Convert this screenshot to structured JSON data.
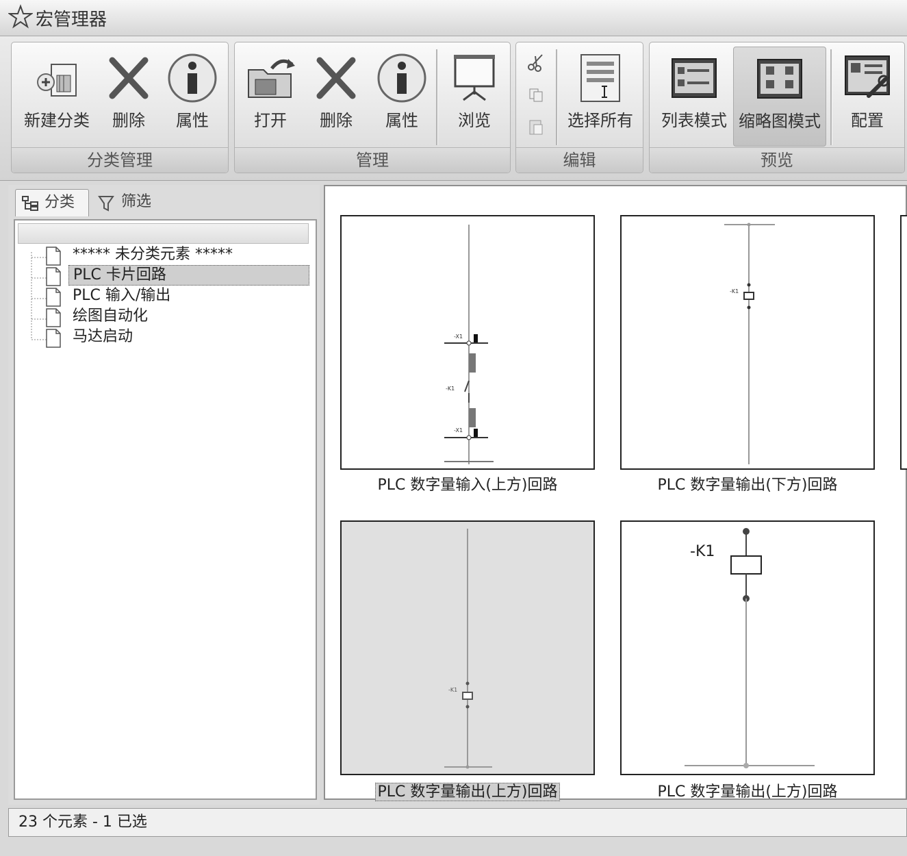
{
  "window": {
    "title": "宏管理器"
  },
  "ribbon": {
    "groups": [
      {
        "title": "分类管理",
        "buttons": [
          "新建分类",
          "删除",
          "属性"
        ]
      },
      {
        "title": "管理",
        "buttons": [
          "打开",
          "删除",
          "属性",
          "浏览"
        ]
      },
      {
        "title": "编辑",
        "buttons": [
          "选择所有"
        ]
      },
      {
        "title": "预览",
        "buttons": [
          "列表模式",
          "缩略图模式",
          "配置"
        ],
        "active": "缩略图模式"
      }
    ]
  },
  "left_panel": {
    "tabs": [
      "分类",
      "筛选"
    ],
    "tree": [
      {
        "label": "***** 未分类元素 *****",
        "selected": false
      },
      {
        "label": "PLC 卡片回路",
        "selected": true
      },
      {
        "label": "PLC 输入/输出",
        "selected": false
      },
      {
        "label": "绘图自动化",
        "selected": false
      },
      {
        "label": "马达启动",
        "selected": false
      }
    ]
  },
  "thumbnails": [
    {
      "caption": "PLC 数字量输入(上方)回路",
      "selected": false,
      "diagram_labels": [
        "-X1",
        "-K1",
        "-X1"
      ]
    },
    {
      "caption": "PLC 数字量输出(下方)回路",
      "selected": false,
      "diagram_labels": [
        "-K1"
      ]
    },
    {
      "caption": "PLC 数字量输出(上方)回路",
      "selected": true,
      "diagram_labels": [
        "-K1"
      ]
    },
    {
      "caption": "PLC 数字量输出(上方)回路",
      "selected": false,
      "diagram_labels": [
        "-K1"
      ]
    }
  ],
  "status": {
    "text": "23 个元素 - 1 已选"
  },
  "icons": {
    "title": "star-icon",
    "ribbon": [
      "new-category-icon",
      "delete-icon",
      "info-icon",
      "open-folder-icon",
      "delete-icon",
      "info-icon",
      "presentation-icon",
      "cut-icon",
      "copy-icon",
      "paste-icon",
      "select-all-icon",
      "list-mode-icon",
      "thumbnail-mode-icon",
      "config-icon"
    ],
    "tabs": [
      "tree-icon",
      "filter-icon"
    ],
    "tree": "document-icon"
  }
}
